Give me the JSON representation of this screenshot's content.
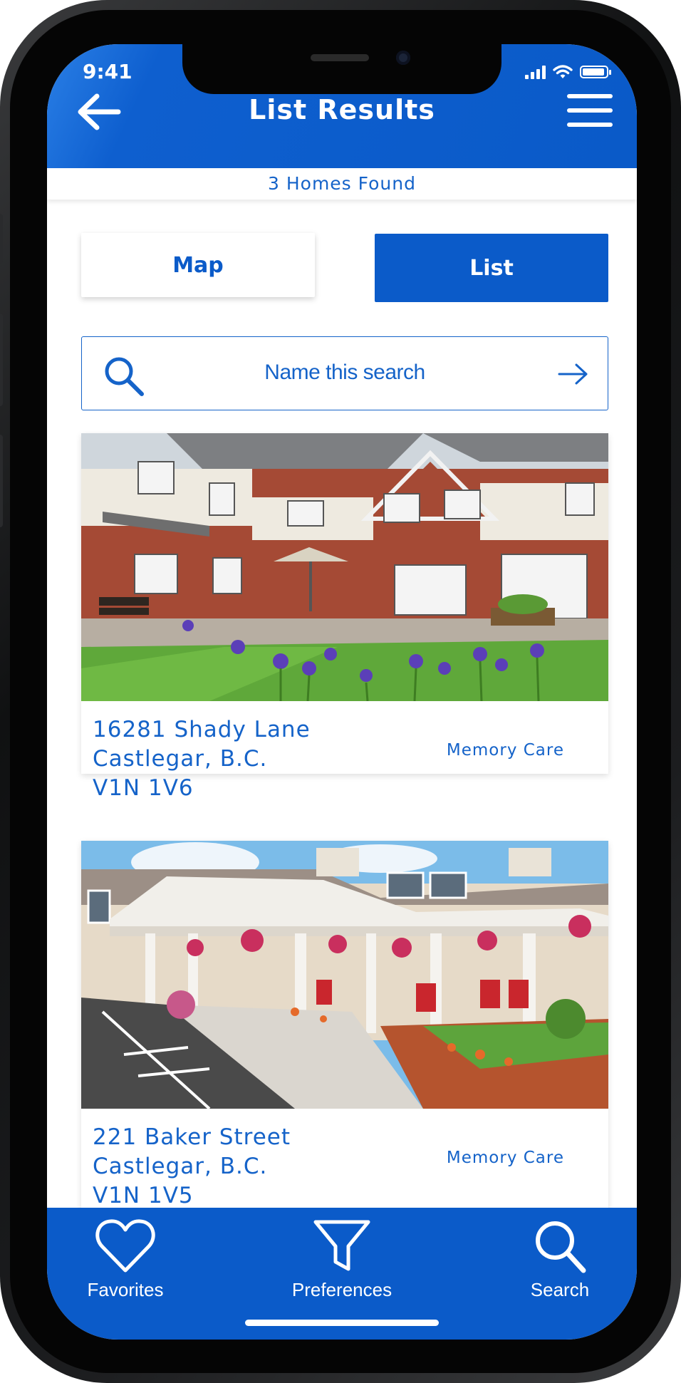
{
  "status_bar": {
    "time": "9:41"
  },
  "header": {
    "title": "List Results"
  },
  "results_count": "3 Homes Found",
  "view_toggle": {
    "map_label": "Map",
    "list_label": "List",
    "selected": "List"
  },
  "search": {
    "label": "Name this search"
  },
  "listings": [
    {
      "address_line1": "16281 Shady Lane",
      "address_line2": "Castlegar, B.C.",
      "postal_code": "V1N 1V6",
      "care_type": "Memory Care"
    },
    {
      "address_line1": "221 Baker Street",
      "address_line2": "Castlegar, B.C.",
      "postal_code": "V1N 1V5",
      "care_type": "Memory Care"
    }
  ],
  "bottom_nav": {
    "items": [
      {
        "label": "Favorites",
        "icon": "heart-icon"
      },
      {
        "label": "Preferences",
        "icon": "filter-icon"
      },
      {
        "label": "Search",
        "icon": "search-icon"
      }
    ]
  },
  "colors": {
    "primary": "#0b5bc9",
    "text_accent": "#1563c9",
    "background": "#ffffff"
  }
}
